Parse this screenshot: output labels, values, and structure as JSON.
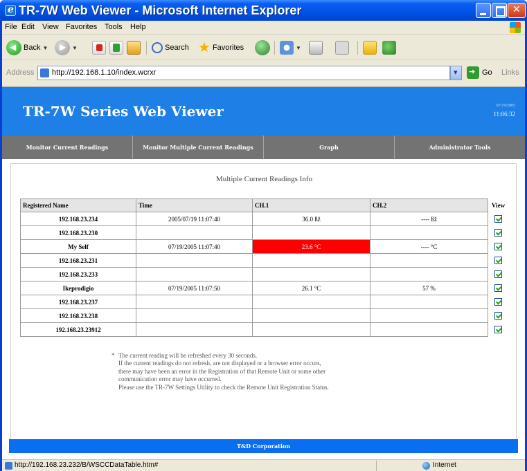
{
  "window": {
    "title": "TR-7W Web Viewer - Microsoft Internet Explorer"
  },
  "menubar": {
    "items": [
      "File",
      "Edit",
      "View",
      "Favorites",
      "Tools",
      "Help"
    ]
  },
  "toolbar": {
    "back_label": "Back",
    "search_label": "Search",
    "favorites_label": "Favorites"
  },
  "addressbar": {
    "label": "Address",
    "url": "http://192.168.1.10/index.wcrxr",
    "go_label": "Go",
    "links_label": "Links"
  },
  "site": {
    "title": "TR-7W Series Web Viewer",
    "header_date": "07/19/2005",
    "header_time": "11:06:32",
    "nav": [
      "Monitor Current Readings",
      "Monitor Multiple Current Readings",
      "Graph",
      "Administrator Tools"
    ]
  },
  "section": {
    "title": "Multiple Current Readings Info"
  },
  "table": {
    "headers": [
      "Registered Name",
      "Time",
      "CH.1",
      "CH.2",
      "View"
    ],
    "rows": [
      {
        "name": "192.168.23.234",
        "time": "2005/07/19 11:07:40",
        "ch1": "36.0 ßž",
        "ch2": "---- ßž",
        "view": true,
        "alarm": false
      },
      {
        "name": "192.168.23.230",
        "time": "",
        "ch1": "",
        "ch2": "",
        "view": true,
        "alarm": false
      },
      {
        "name": "My Self",
        "time": "07/19/2005 11:07:40",
        "ch1": "23.6 °C",
        "ch2": "---- °C",
        "view": true,
        "alarm": true
      },
      {
        "name": "192.168.23.231",
        "time": "",
        "ch1": "",
        "ch2": "",
        "view": true,
        "alarm": false
      },
      {
        "name": "192.168.23.233",
        "time": "",
        "ch1": "",
        "ch2": "",
        "view": true,
        "alarm": false
      },
      {
        "name": "Ikeprodigio",
        "time": "07/19/2005 11:07:50",
        "ch1": "26.1 °C",
        "ch2": "57 %",
        "view": true,
        "alarm": false
      },
      {
        "name": "192.168.23.237",
        "time": "",
        "ch1": "",
        "ch2": "",
        "view": true,
        "alarm": false
      },
      {
        "name": "192.168.23.238",
        "time": "",
        "ch1": "",
        "ch2": "",
        "view": true,
        "alarm": false
      },
      {
        "name": "192.168.23.23912",
        "time": "",
        "ch1": "",
        "ch2": "",
        "view": true,
        "alarm": false
      }
    ]
  },
  "notes": {
    "bullet": "*",
    "lines": [
      "The current reading will be refreshed every 30 seconds.",
      "If the current readings do not refresh, are not displayed or a browser error occurs,",
      "there may have been an error in the Registration of that Remote Unit or some other",
      "communication error may have occurred.",
      "Please use the TR-7W Settings Utility to check the Remote Unit Registration Status."
    ]
  },
  "footer": {
    "text": "T&D Corporation"
  },
  "statusbar": {
    "text": "http://192.168.23.232/B/WSCCDataTable.htm#",
    "zone": "Internet"
  },
  "colors": {
    "header_blue": "#1e7fe6",
    "nav_gray": "#737373",
    "alarm_red": "#ff0000",
    "footer_blue": "#0a6ef0"
  }
}
